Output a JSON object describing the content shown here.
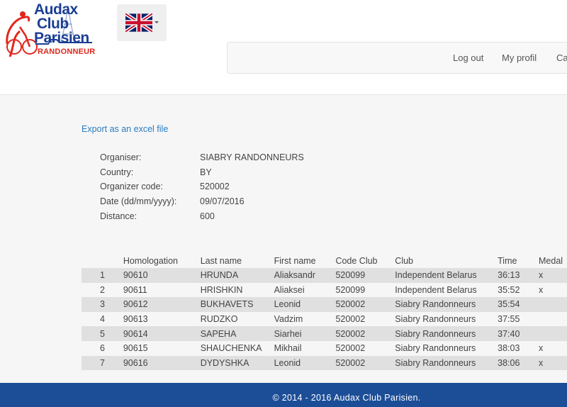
{
  "brand": {
    "name_line1": "Audax",
    "name_line2": "Club",
    "name_line3": "Parisien",
    "subtitle": "RANDONNEUR",
    "primary_color": "#1c3f94",
    "accent_color": "#e2261c"
  },
  "language": {
    "selected_flag": "uk-flag-icon"
  },
  "nav": {
    "items": [
      {
        "label": "Log out"
      },
      {
        "label": "My profil"
      },
      {
        "label": "Ca"
      }
    ]
  },
  "export_link": "Export as an excel file",
  "info": [
    {
      "label": "Organiser:",
      "value": "SIABRY RANDONNEURS"
    },
    {
      "label": "Country:",
      "value": "BY"
    },
    {
      "label": "Organizer code:",
      "value": "520002"
    },
    {
      "label": "Date (dd/mm/yyyy):",
      "value": "09/07/2016"
    },
    {
      "label": "Distance:",
      "value": "600"
    }
  ],
  "table": {
    "headers": [
      "",
      "Homologation",
      "Last name",
      "First name",
      "Code Club",
      "Club",
      "Time",
      "Medal"
    ],
    "rows": [
      [
        "1",
        "90610",
        "HRUNDA",
        "Aliaksandr",
        "520099",
        "Independent Belarus",
        "36:13",
        "x"
      ],
      [
        "2",
        "90611",
        "HRISHKIN",
        "Aliaksei",
        "520099",
        "Independent Belarus",
        "35:52",
        "x"
      ],
      [
        "3",
        "90612",
        "BUKHAVETS",
        "Leonid",
        "520002",
        "Siabry Randonneurs",
        "35:54",
        ""
      ],
      [
        "4",
        "90613",
        "RUDZKO",
        "Vadzim",
        "520002",
        "Siabry Randonneurs",
        "37:55",
        ""
      ],
      [
        "5",
        "90614",
        "SAPEHA",
        "Siarhei",
        "520002",
        "Siabry Randonneurs",
        "37:40",
        ""
      ],
      [
        "6",
        "90615",
        "SHAUCHENKA",
        "Mikhail",
        "520002",
        "Siabry Randonneurs",
        "38:03",
        "x"
      ],
      [
        "7",
        "90616",
        "DYDYSHKA",
        "Leonid",
        "520002",
        "Siabry Randonneurs",
        "38:06",
        "x"
      ]
    ]
  },
  "footer": {
    "text": "© 2014 - 2016 Audax Club Parisien."
  },
  "colors": {
    "footer_bg": "#1c4e97",
    "link": "#2a7cc0",
    "row_shade": "#e0e0e0"
  }
}
